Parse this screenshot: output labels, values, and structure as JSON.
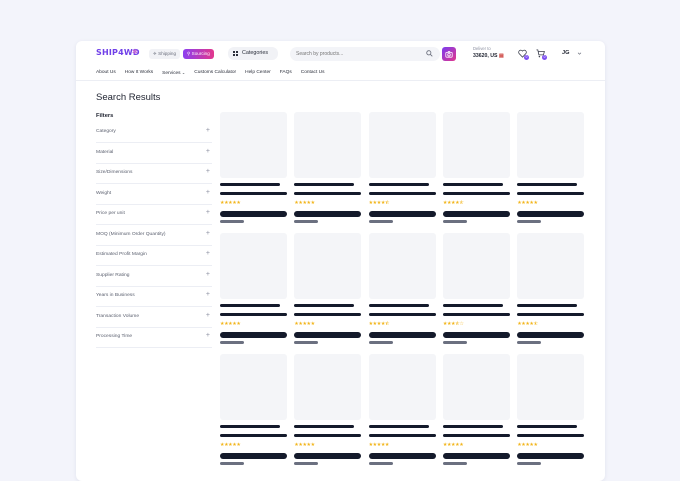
{
  "header": {
    "logo": "SHIP4WD",
    "mode_shipping": "Shipping",
    "mode_sourcing": "Sourcing",
    "categories_label": "Categories",
    "search_placeholder": "Search by products...",
    "deliver_label": "Deliver to",
    "deliver_value": "33620, US",
    "wishlist_count": "0",
    "cart_count": "0",
    "user_initials": "JG"
  },
  "nav": [
    "About Us",
    "How It Works",
    "Services",
    "Customs Calculator",
    "Help Center",
    "FAQs",
    "Contact Us"
  ],
  "page": {
    "title": "Search Results",
    "filters_heading": "Filters"
  },
  "filters": [
    "Category",
    "Material",
    "Size/Dimensions",
    "Weight",
    "Price per unit",
    "MOQ (Minimum Order Quantity)",
    "Estimated Profit Margin",
    "Supplier Rating",
    "Years in Business",
    "Transaction Volume",
    "Processing Time"
  ],
  "product_ratings": [
    5,
    5,
    4.5,
    4.5,
    5,
    5,
    5,
    4.5,
    3.5,
    4.5,
    5,
    5,
    5,
    5,
    5
  ],
  "colors": {
    "brand": "#6f3fe8",
    "sourcing_gradient_start": "#8c3ff0",
    "sourcing_gradient_end": "#e2378c",
    "star": "#f2b51b",
    "skeleton_dark": "#141a2b"
  }
}
